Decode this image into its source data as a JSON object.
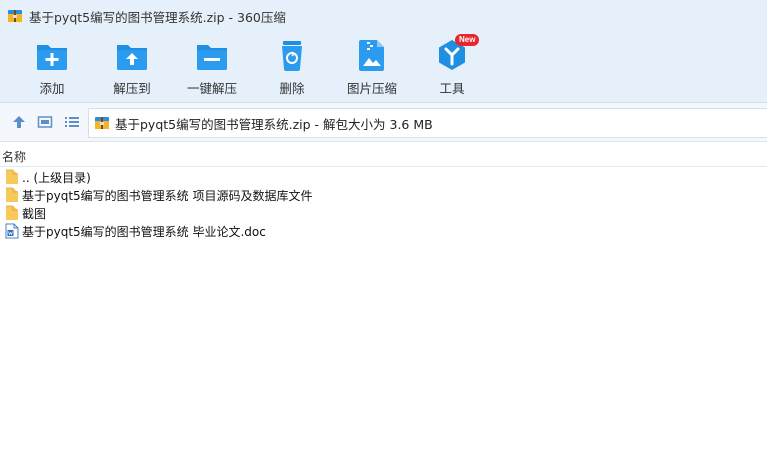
{
  "window": {
    "title": "基于pyqt5编写的图书管理系统.zip - 360压缩"
  },
  "toolbar": {
    "buttons": [
      {
        "label": "添加",
        "icon": "add-icon"
      },
      {
        "label": "解压到",
        "icon": "extract-to-icon"
      },
      {
        "label": "一键解压",
        "icon": "one-click-extract-icon"
      },
      {
        "label": "删除",
        "icon": "trash-icon"
      },
      {
        "label": "图片压缩",
        "icon": "image-compress-icon"
      },
      {
        "label": "工具",
        "icon": "tools-icon",
        "badge": "New"
      }
    ]
  },
  "address": {
    "text": "基于pyqt5编写的图书管理系统.zip - 解包大小为 3.6 MB"
  },
  "list": {
    "column_name": "名称",
    "items": [
      {
        "name": ".. (上级目录)",
        "type": "parent-folder"
      },
      {
        "name": "基于pyqt5编写的图书管理系统 项目源码及数据库文件",
        "type": "folder"
      },
      {
        "name": "截图",
        "type": "folder"
      },
      {
        "name": "基于pyqt5编写的图书管理系统 毕业论文.doc",
        "type": "doc-file"
      }
    ]
  },
  "colors": {
    "accent_blue": "#1e8fe1",
    "toolbar_bg": "#e6f0fb",
    "folder_yellow": "#f6c95a",
    "badge_red": "#e8262d"
  }
}
